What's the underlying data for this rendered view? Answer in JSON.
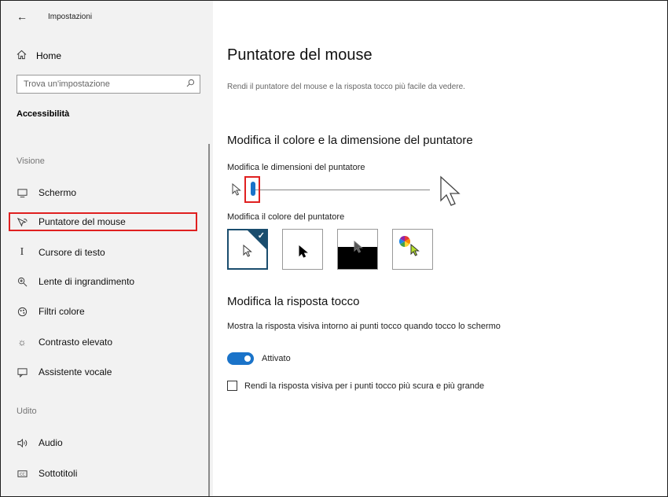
{
  "window": {
    "title": "Impostazioni"
  },
  "sidebar": {
    "home_label": "Home",
    "search": {
      "placeholder": "Trova un'impostazione",
      "value": ""
    },
    "category": "Accessibilità",
    "sections": [
      {
        "label": "Visione",
        "items": [
          {
            "label": "Schermo",
            "icon": "monitor-icon"
          },
          {
            "label": "Puntatore del mouse",
            "icon": "mouse-pointer-icon",
            "selected": true
          },
          {
            "label": "Cursore di testo",
            "icon": "text-cursor-icon"
          },
          {
            "label": "Lente di ingrandimento",
            "icon": "magnifier-icon"
          },
          {
            "label": "Filtri colore",
            "icon": "color-filter-icon"
          },
          {
            "label": "Contrasto elevato",
            "icon": "contrast-icon"
          },
          {
            "label": "Assistente vocale",
            "icon": "narrator-icon"
          }
        ]
      },
      {
        "label": "Udito",
        "items": [
          {
            "label": "Audio",
            "icon": "speaker-icon"
          },
          {
            "label": "Sottotitoli",
            "icon": "captions-icon"
          }
        ]
      }
    ]
  },
  "main": {
    "title": "Puntatore del mouse",
    "description": "Rendi il puntatore del mouse e la risposta tocco più facile da vedere.",
    "pointer_section": {
      "heading": "Modifica il colore e la dimensione del puntatore",
      "size_label": "Modifica le dimensioni del puntatore",
      "size_value_fraction": 0.05,
      "color_label": "Modifica il colore del puntatore",
      "color_options": [
        "white",
        "black",
        "inverted",
        "custom"
      ],
      "selected_color": "white"
    },
    "touch_section": {
      "heading": "Modifica la risposta tocco",
      "visual_feedback_label": "Mostra la risposta visiva intorno ai punti tocco quando tocco lo schermo",
      "toggle_state_label": "Attivato",
      "toggle_on": true,
      "darker_label": "Rendi la risposta visiva per i punti tocco più scura e più grande",
      "darker_checked": false
    }
  },
  "colors": {
    "accent": "#1a73c9",
    "highlight": "#e02020",
    "selected_swatch": "#1a4d6e"
  }
}
